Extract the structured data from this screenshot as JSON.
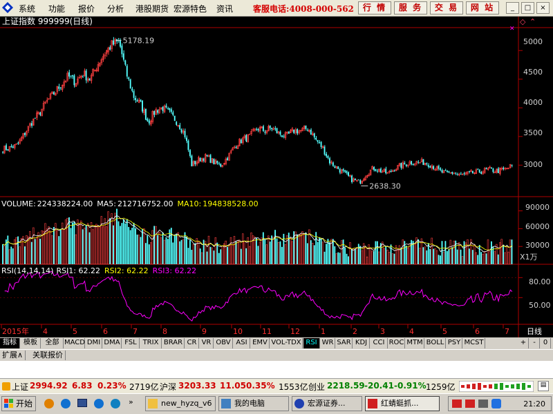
{
  "menu": {
    "items": [
      "系统",
      "功能",
      "报价",
      "分析",
      "港股期货",
      "宏源特色",
      "资讯"
    ],
    "hotline": "客服电话:4008-000-562",
    "quick": [
      "行 情",
      "服 务",
      "交 易",
      "网 站"
    ],
    "win": [
      "_",
      "□",
      "×"
    ]
  },
  "chart_title": "上证指数 999999(日线)",
  "price_labels": {
    "high": "5178.19",
    "low": "2638.30"
  },
  "price_axis": [
    "5000",
    "4500",
    "4000",
    "3500",
    "3000"
  ],
  "volume": {
    "label": "VOLUME:",
    "value": "224338224.00",
    "ma5_label": "MA5:",
    "ma5": "212716752.00",
    "ma10_label": "MA10:",
    "ma10": "194838528.00",
    "axis": [
      "90000",
      "60000",
      "30000"
    ],
    "unit": "X1万"
  },
  "rsi": {
    "label": "RSI(14,14,14)",
    "rsi1": "RSI1: 62.22",
    "rsi2": "RSI2: 62.22",
    "rsi3": "RSI3: 62.22",
    "axis": [
      "80.00",
      "50.00"
    ]
  },
  "months": [
    "2015年",
    "4",
    "5",
    "6",
    "7",
    "8",
    "9",
    "10",
    "11",
    "12",
    "1",
    "2",
    "3",
    "4",
    "5",
    "6",
    "7"
  ],
  "period": "日线",
  "indicator_tabs": [
    "指标",
    "模板",
    "全部",
    "MACD",
    "DMI",
    "DMA",
    "FSL",
    "TRIX",
    "BRAR",
    "CR",
    "VR",
    "OBV",
    "ASI",
    "EMV",
    "VOL-TDX",
    "RSI",
    "WR",
    "SAR",
    "KDJ",
    "CCI",
    "ROC",
    "MTM",
    "BOLL",
    "PSY",
    "MCST"
  ],
  "selected_tab": "RSI",
  "tab_tools": [
    "+",
    "-",
    "0"
  ],
  "bottom_tabs": [
    "扩展∧",
    "关联报价"
  ],
  "status": {
    "sh_name": "上证",
    "sh_val": "2994.92",
    "sh_chg": "6.83",
    "sh_pct": "0.23%",
    "sh_amt": "2719亿",
    "hs_name": "沪深",
    "hs_val": "3203.33",
    "hs_chg": "11.05",
    "hs_pct": "0.35%",
    "hs_amt": "1553亿",
    "cy_name": "创业",
    "cy_val": "2218.59",
    "cy_chg": "-20.41",
    "cy_pct": "-0.91%",
    "cy_amt": "1259亿"
  },
  "taskbar": {
    "start": "开始",
    "windows": [
      "new_hyzq_v6",
      "我的电脑",
      "宏源证券...",
      "红蜻蜓抓..."
    ],
    "time": "21:20"
  },
  "colors": {
    "up": "#ff4040",
    "down": "#54ffff",
    "ma5": "#ffffff",
    "ma10": "#ffff00",
    "rsi": "#ff00ff",
    "axis": "#b00000"
  },
  "chart_data": {
    "type": "candlestick",
    "title": "上证指数 999999(日线)",
    "ylim": [
      2450,
      5400
    ],
    "x": [
      "2015年",
      "4",
      "5",
      "6",
      "7",
      "8",
      "9",
      "10",
      "11",
      "12",
      "1",
      "2",
      "3",
      "4",
      "5",
      "6",
      "7"
    ],
    "close_path": [
      3280,
      3300,
      3350,
      3550,
      3750,
      3900,
      4100,
      4250,
      4400,
      4550,
      4450,
      4600,
      4500,
      4750,
      4950,
      5100,
      5150,
      4600,
      4200,
      4050,
      3750,
      3950,
      4000,
      3900,
      3750,
      3550,
      3000,
      3100,
      3150,
      3050,
      3000,
      3150,
      3350,
      3450,
      3500,
      3650,
      3600,
      3650,
      3550,
      3500,
      3600,
      3600,
      3650,
      3450,
      3300,
      3050,
      2950,
      2850,
      2750,
      2700,
      2850,
      2950,
      2900,
      2850,
      2950,
      3000,
      3050,
      3050,
      3050,
      3000,
      2900,
      2850,
      2870,
      2820,
      2850,
      2870,
      2900,
      2920,
      2900,
      2920,
      2990
    ],
    "high_label": 5178.19,
    "low_label": 2638.3,
    "volume_ylim": [
      0,
      100000
    ],
    "rsi_ylim": [
      10,
      100
    ]
  }
}
